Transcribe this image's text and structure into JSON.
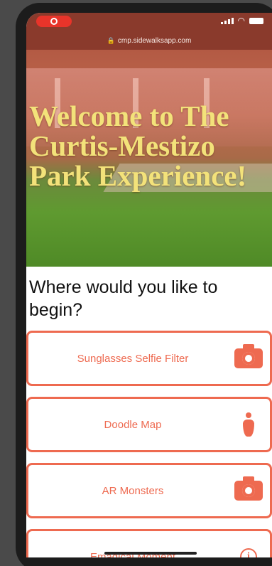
{
  "browser": {
    "url": "cmp.sidewalksapp.com"
  },
  "hero": {
    "title": "Welcome to The Curtis-Mestizo Park Experience!"
  },
  "prompt": "Where would you like to begin?",
  "options": [
    {
      "label": "Sunglasses Selfie Filter",
      "icon": "camera-icon"
    },
    {
      "label": "Doodle Map",
      "icon": "person-pin-icon"
    },
    {
      "label": "AR Monsters",
      "icon": "camera-icon"
    },
    {
      "label": "Emagical Moment",
      "icon": "info-icon"
    }
  ],
  "colors": {
    "accent": "#ee6a50",
    "hero_title": "#f3e27a",
    "status_bar": "#8a3a2c",
    "recording": "#e8342a"
  }
}
